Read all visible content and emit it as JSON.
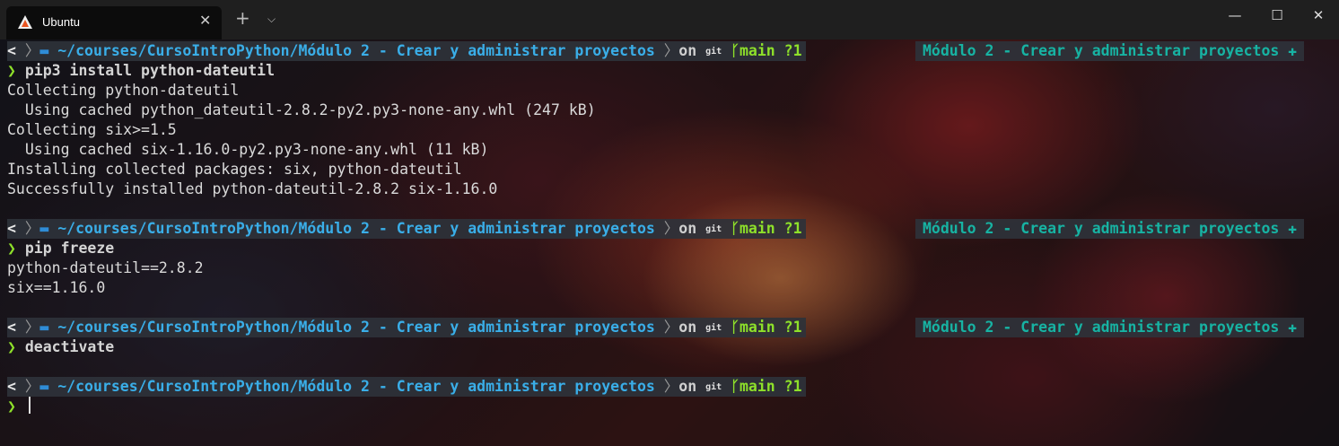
{
  "window": {
    "tab_title": "Ubuntu",
    "close_tab": "✕",
    "new_tab": "+",
    "dropdown": "⌵",
    "minimize": "—",
    "maximize": "☐",
    "close": "✕"
  },
  "prompt": {
    "os_icon": "<",
    "folder_icon": "▬",
    "path_home": "~/courses/",
    "path_current": "CursoIntroPython/Módulo 2 - Crear y administrar proyectos",
    "separator": "〉",
    "on": "on",
    "git_label": "git",
    "branch_icon": "ᚴ",
    "branch": "main ?1",
    "right_text": "Módulo 2 - Crear y administrar proyectos",
    "right_icon": "✚",
    "chevron": "❯"
  },
  "blocks": [
    {
      "command": "pip3 install python-dateutil",
      "output": [
        "Collecting python-dateutil",
        "  Using cached python_dateutil-2.8.2-py2.py3-none-any.whl (247 kB)",
        "Collecting six>=1.5",
        "  Using cached six-1.16.0-py2.py3-none-any.whl (11 kB)",
        "Installing collected packages: six, python-dateutil",
        "Successfully installed python-dateutil-2.8.2 six-1.16.0"
      ]
    },
    {
      "command": "pip freeze",
      "output": [
        "python-dateutil==2.8.2",
        "six==1.16.0"
      ]
    },
    {
      "command": "deactivate",
      "output": []
    },
    {
      "command": "",
      "output": []
    }
  ],
  "colors": {
    "path": "#3aaee8",
    "branch": "#8ee02a",
    "right_prompt": "#17b3a3",
    "segment_bg": "#2e323a"
  }
}
